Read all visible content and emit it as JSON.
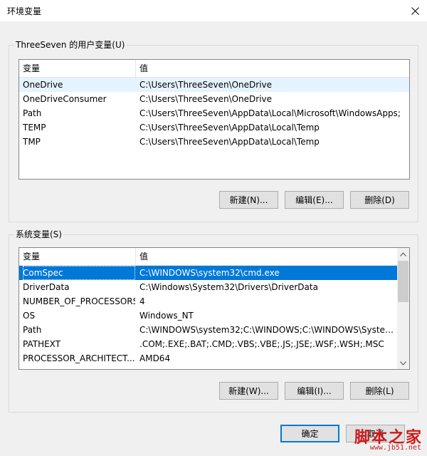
{
  "window": {
    "title": "环境变量",
    "close_icon": "close-icon"
  },
  "user_vars": {
    "group_label": "ThreeSeven 的用户变量(U)",
    "headers": {
      "name": "变量",
      "value": "值"
    },
    "rows": [
      {
        "name": "OneDrive",
        "value": "C:\\Users\\ThreeSeven\\OneDrive"
      },
      {
        "name": "OneDriveConsumer",
        "value": "C:\\Users\\ThreeSeven\\OneDrive"
      },
      {
        "name": "Path",
        "value": "C:\\Users\\ThreeSeven\\AppData\\Local\\Microsoft\\WindowsApps;"
      },
      {
        "name": "TEMP",
        "value": "C:\\Users\\ThreeSeven\\AppData\\Local\\Temp"
      },
      {
        "name": "TMP",
        "value": "C:\\Users\\ThreeSeven\\AppData\\Local\\Temp"
      }
    ],
    "buttons": {
      "new": "新建(N)...",
      "edit": "编辑(E)...",
      "delete": "删除(D)"
    }
  },
  "system_vars": {
    "group_label": "系统变量(S)",
    "headers": {
      "name": "变量",
      "value": "值"
    },
    "rows": [
      {
        "name": "ComSpec",
        "value": "C:\\WINDOWS\\system32\\cmd.exe"
      },
      {
        "name": "DriverData",
        "value": "C:\\Windows\\System32\\Drivers\\DriverData"
      },
      {
        "name": "NUMBER_OF_PROCESSORS",
        "value": "4"
      },
      {
        "name": "OS",
        "value": "Windows_NT"
      },
      {
        "name": "Path",
        "value": "C:\\WINDOWS\\system32;C:\\WINDOWS;C:\\WINDOWS\\System..."
      },
      {
        "name": "PATHEXT",
        "value": ".COM;.EXE;.BAT;.CMD;.VBS;.VBE;.JS;.JSE;.WSF;.WSH;.MSC"
      },
      {
        "name": "PROCESSOR_ARCHITECT...",
        "value": "AMD64"
      }
    ],
    "selected_index": 0,
    "buttons": {
      "new": "新建(W)...",
      "edit": "编辑(I)...",
      "delete": "删除(L)"
    }
  },
  "footer": {
    "ok": "确定",
    "cancel": "取消"
  },
  "watermark": {
    "main": "脚本之家",
    "sub": "www.jb51.net"
  },
  "colors": {
    "accent": "#0078d7",
    "watermark": "#cc1a1a"
  }
}
